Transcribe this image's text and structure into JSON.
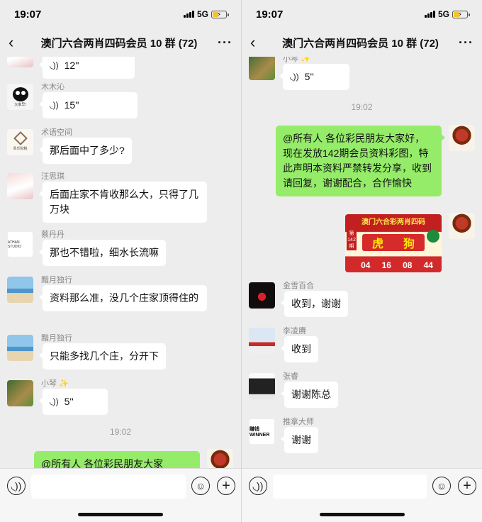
{
  "status": {
    "time": "19:07",
    "network": "5G"
  },
  "header": {
    "title": "澳门六合两肖四码会员 10 群 (72)"
  },
  "left": {
    "messages": [
      {
        "name": "",
        "voice": "12''"
      },
      {
        "name": "木木沁",
        "voice": "15''",
        "avatar_text": "大家早!"
      },
      {
        "name": "术语空间",
        "text": "那后面中了多少?",
        "avatar_text": "贵乐财税"
      },
      {
        "name": "汪思琪",
        "text": "后面庄家不肯收那么大，只得了几万块"
      },
      {
        "name": "蔡丹丹",
        "text": "那也不错啦，细水长流嘛",
        "avatar_text": "ATHAN STUDIO"
      },
      {
        "name": "黯月独行",
        "text": "资料那么准，没几个庄家顶得住的"
      },
      {
        "name": "黯月独行",
        "text": "只能多找几个庄，分开下"
      },
      {
        "name": "小琴 ✨",
        "voice": "5''"
      }
    ],
    "timestamp": "19:02",
    "partial_text": "@所有人 各位彩民朋友大家"
  },
  "right": {
    "top_voice": {
      "name": "小琴 ✨",
      "voice": "5''"
    },
    "timestamp": "19:02",
    "announcement": "@所有人 各位彩民朋友大家好，现在发放142期会员资料彩图，特此声明本资料严禁转发分享，收到请回复，谢谢配合，合作愉快",
    "lottery": {
      "title": "澳门六合彩两肖四码",
      "side": "第142期",
      "zodiac": [
        "虎",
        "狗"
      ],
      "numbers": [
        "04",
        "16",
        "08",
        "44"
      ]
    },
    "messages": [
      {
        "name": "金雪百合",
        "text": "收到，谢谢"
      },
      {
        "name": "李凌赓",
        "text": "收到"
      },
      {
        "name": "张睿",
        "text": "谢谢陈总"
      },
      {
        "name": "推拿大师",
        "text": "谢谢",
        "avatar_text": "赚钱 WINNER"
      }
    ]
  },
  "icons": {
    "back": "back-arrow-icon",
    "more": "more-dots-icon",
    "voice": "voice-wave-icon",
    "emoji": "emoji-icon",
    "plus": "plus-icon"
  }
}
